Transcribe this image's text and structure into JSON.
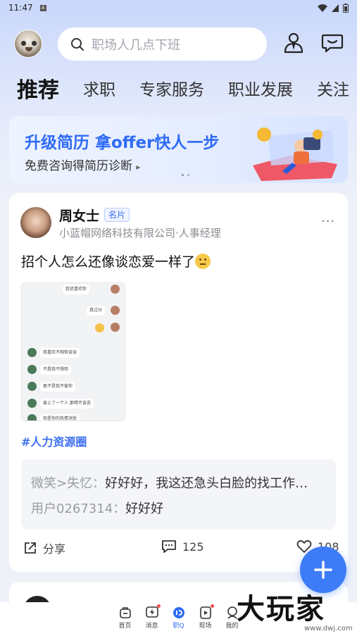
{
  "status_bar": {
    "time": "11:47",
    "notif_glyph": "A"
  },
  "header": {
    "search_placeholder": "职场人几点下班",
    "icons": [
      "avatar",
      "search-icon",
      "recruiter-icon",
      "message-icon"
    ]
  },
  "tabs": [
    "推荐",
    "求职",
    "专家服务",
    "职业发展",
    "关注"
  ],
  "banner": {
    "title": "升级简历 拿offer快人一步",
    "subtitle": "免费咨询得简历诊断",
    "arrow": "▸"
  },
  "post": {
    "author": "周女士",
    "badge": "名片",
    "company": "小蓝帽网络科技有限公司·人事经理",
    "more": "···",
    "text": "招个人怎么还像谈恋爱一样了",
    "chat_lines": [
      "我还喜欢你",
      "真过分",
      "我喜欢不相但谈谈",
      "不是我不想但",
      "更不是我不爱你",
      "爱上了一个人 那晴不该说",
      "但是你的热情消受"
    ],
    "hashtag": "#人力资源圈",
    "comments": [
      {
        "who": "微笑>失忆：",
        "text": "好好好，我这还急头白脸的找工作…"
      },
      {
        "who": "用户0267314：",
        "text": "好好好"
      }
    ],
    "share_label": "分享",
    "comment_count": "125",
    "like_count": "108"
  },
  "bottom_nav": [
    {
      "label": "首页",
      "icon": "home-icon",
      "dot": false,
      "active": false
    },
    {
      "label": "消息",
      "icon": "lightning-message-icon",
      "dot": true,
      "active": false
    },
    {
      "label": "职Q",
      "icon": "zhiq-icon",
      "dot": false,
      "active": true
    },
    {
      "label": "现场",
      "icon": "live-icon",
      "dot": true,
      "active": false
    },
    {
      "label": "我的",
      "icon": "profile-icon",
      "dot": false,
      "active": false
    }
  ],
  "watermark": {
    "big": "大玩家",
    "small": "www.dwj.com"
  },
  "colors": {
    "accent": "#2f6cf6",
    "fab": "#3d7cf7",
    "hashtag": "#3b6ef0"
  }
}
